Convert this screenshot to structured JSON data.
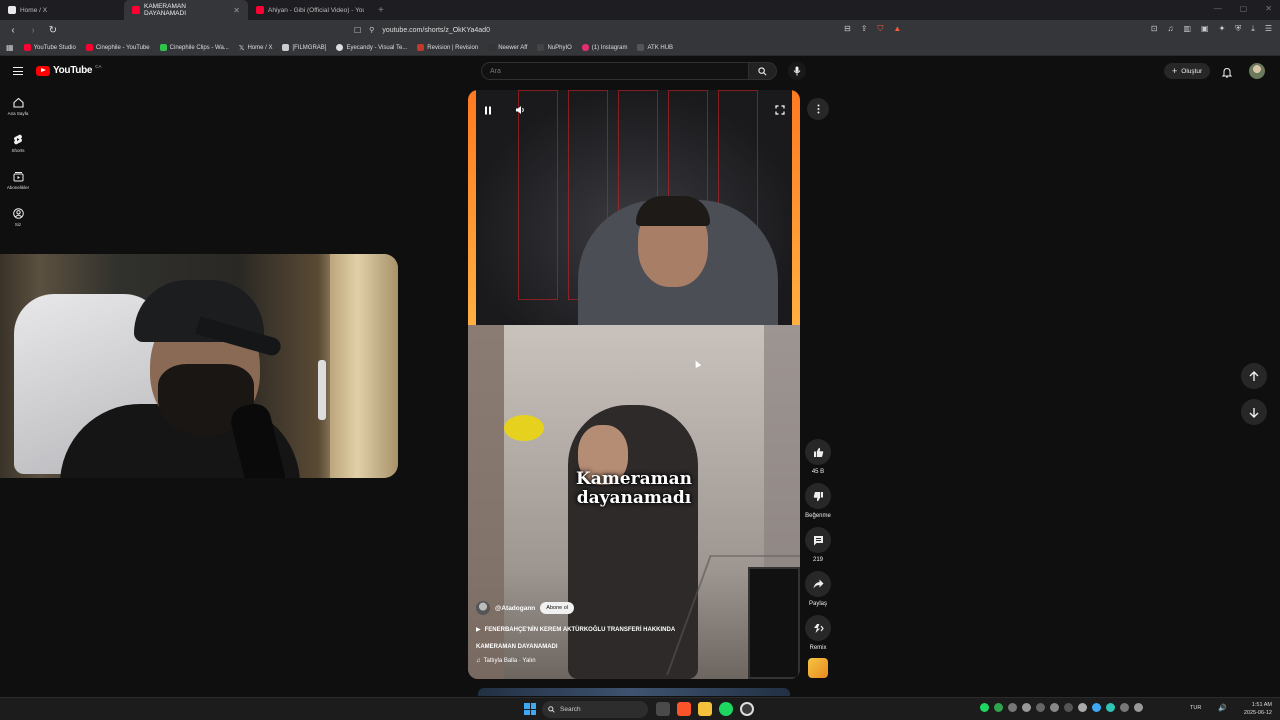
{
  "browser": {
    "tabs": [
      {
        "label": "Home / X",
        "favicon_color": "#e7e9ea",
        "active": false
      },
      {
        "label": "KAMERAMAN DAYANAMADI",
        "favicon_color": "#ff0033",
        "active": true
      },
      {
        "label": "Ahiyan - Gibi (Official Video) - YouTu",
        "favicon_color": "#ff0033",
        "active": false
      }
    ],
    "url": "youtube.com/shorts/z_OkKYa4ad0",
    "bookmarks": [
      {
        "label": "YouTube Studio",
        "color": "#ff0033"
      },
      {
        "label": "Cinephile - YouTube",
        "color": "#ff0033"
      },
      {
        "label": "Cinephile Clips - Wa...",
        "color": "#2ec44c"
      },
      {
        "label": "Home / X",
        "color": "#e7e9ea"
      },
      {
        "label": "[FILMGRAB]",
        "color": "#cccccc"
      },
      {
        "label": "Eyecandy - Visual Te...",
        "color": "#dddddd"
      },
      {
        "label": "Revision | Revision",
        "color": "#c0392b"
      },
      {
        "label": "Neewer Aff",
        "color": "#333333"
      },
      {
        "label": "NuPhyIO",
        "color": "#444444"
      },
      {
        "label": "(1) Instagram",
        "color": "#e1306c"
      },
      {
        "label": "ATK HUB",
        "color": "#555555"
      }
    ]
  },
  "youtube": {
    "logo_text": "YouTube",
    "logo_region": "CA",
    "search_placeholder": "Ara",
    "create_label": "Oluştur",
    "sidebar": [
      {
        "label": "Ana Sayfa",
        "icon": "home-icon"
      },
      {
        "label": "Shorts",
        "icon": "shorts-icon"
      },
      {
        "label": "Abonelikler",
        "icon": "subscriptions-icon"
      },
      {
        "label": "Siz",
        "icon": "you-icon"
      }
    ]
  },
  "short": {
    "overlay_title_line1": "Kameraman",
    "overlay_title_line2": "dayanamadı",
    "channel": "@Atadogann",
    "subscribe_label": "Abone ol",
    "description": "FENERBAHÇE'NİN KEREM AKTÜRKOĞLU TRANSFERİ HAKKINDA",
    "title": "KAMERAMAN DAYANAMADI",
    "music": "Tatlıyla Balla · Yalın",
    "actions": {
      "like_count": "45 B",
      "dislike_label": "Beğenme",
      "comment_count": "219",
      "share_label": "Paylaş",
      "remix_label": "Remix"
    }
  },
  "taskbar": {
    "search_label": "Search",
    "language": "TUR",
    "time": "1:51 AM",
    "date": "2025-06-12",
    "accent": "#3da8f5"
  }
}
